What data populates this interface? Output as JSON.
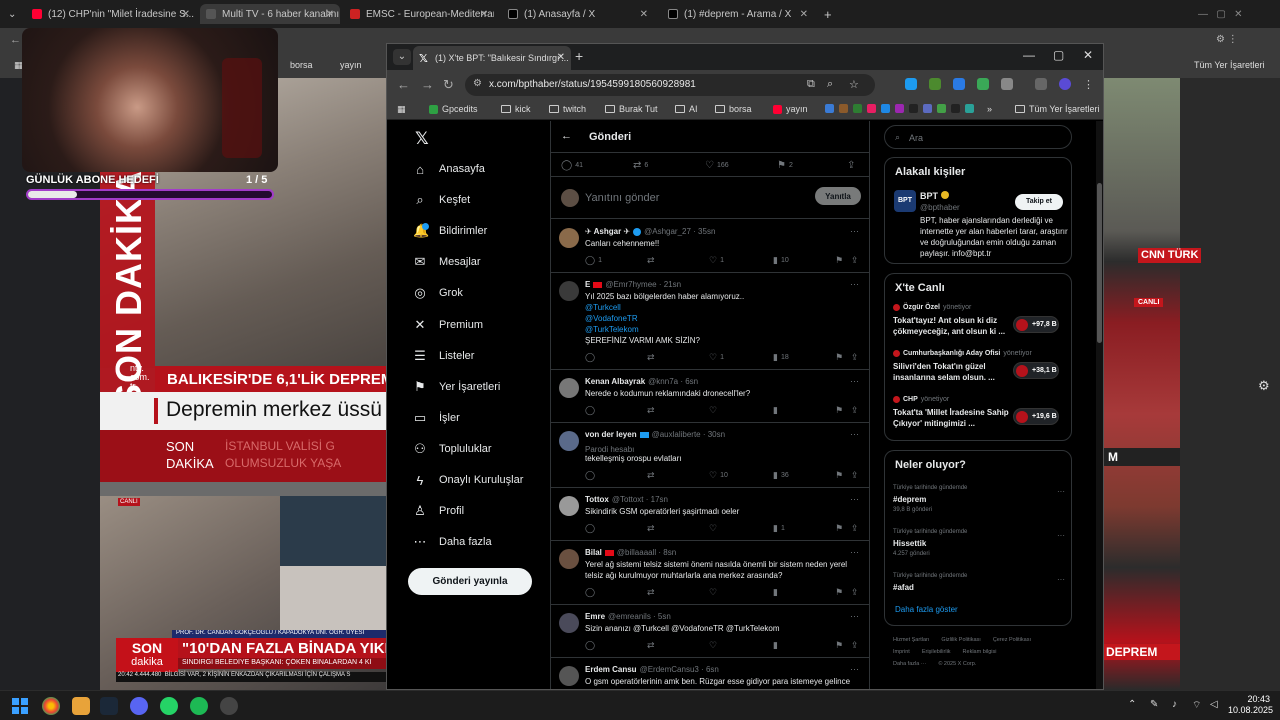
{
  "bg_tabs": [
    {
      "label": "(12) CHP'nin \"Milet İradesine S...",
      "color": "#ff0033"
    },
    {
      "label": "Multi TV - 6 haber kanalını...",
      "color": "#555555"
    },
    {
      "label": "EMSC - European-Mediterrane...",
      "color": "#cc2222"
    },
    {
      "label": "(1) Anasayfa / X",
      "color": "#000000"
    },
    {
      "label": "(1) #deprem - Arama / X",
      "color": "#000000"
    }
  ],
  "bg_bookmarks": {
    "borsa": "borsa",
    "yayin": "yayın",
    "all": "Tüm Yer İşaretleri"
  },
  "stream": {
    "sub_label": "GÜNLÜK ABONE HEDEFİ",
    "sub_count": "1 / 5",
    "sub_progress": 0.2
  },
  "news_left": {
    "vertical": "SON DAKİKA",
    "ntv": "ntv.\ncom.\ntr",
    "headline1": "BALIKESİR'DE 6,1'LİK DEPREM",
    "headline2": "Depremin merkez üssü",
    "son": "SON",
    "dakika": "DAKİKA",
    "ist1": "İSTANBUL VALİSİ G",
    "ist2": "OLUMSUZLUK YAŞA",
    "canli": "CANLI",
    "prof": "PROF. DR. CANDAN GÖKÇEOĞLU / KAPADOKYA ÜNİ. ÖĞR. ÜYESİ",
    "son2": "SON",
    "dakika2": "dakika",
    "head2": "\"10'DAN FAZLA BİNADA YIKILMA",
    "head3": "SINDIRGI BELEDİYE BAŞKANI: ÇÖKEN BİNALARDAN 4 Kİ",
    "ticker": "20:42  4.444.480",
    "bilgi": "BİLGİSİ VAR, 2 KİŞİNİN ENKAZDAN ÇIKARILMASI İÇİN ÇALIŞMA S"
  },
  "news_right": {
    "cnn": "CNN TÜRK",
    "canli": "CANLI",
    "m": "M",
    "dep": "DEPREM"
  },
  "window": {
    "tab_title": "(1) X'te BPT: \"Balıkesir Sındırgı'...",
    "url": "x.com/bpthaber/status/1954599180560928981"
  },
  "bookmarks": [
    {
      "label": "Gpcedits",
      "type": "icon",
      "color": "#2ea043"
    },
    {
      "label": "kick",
      "type": "folder"
    },
    {
      "label": "twitch",
      "type": "folder"
    },
    {
      "label": "Burak Tut",
      "type": "folder"
    },
    {
      "label": "AI",
      "type": "folder"
    },
    {
      "label": "borsa",
      "type": "folder"
    },
    {
      "label": "yayın",
      "type": "icon",
      "color": "#ff0033"
    }
  ],
  "bookmarks_all": "Tüm Yer İşaretleri",
  "nav": {
    "items": [
      {
        "label": "Anasayfa",
        "icon": "⌂"
      },
      {
        "label": "Keşfet",
        "icon": "⌕"
      },
      {
        "label": "Bildirimler",
        "icon": "🔔"
      },
      {
        "label": "Mesajlar",
        "icon": "✉"
      },
      {
        "label": "Grok",
        "icon": "◎"
      },
      {
        "label": "Premium",
        "icon": "✕"
      },
      {
        "label": "Listeler",
        "icon": "☰"
      },
      {
        "label": "Yer İşaretleri",
        "icon": "⚑"
      },
      {
        "label": "İşler",
        "icon": "▭"
      },
      {
        "label": "Topluluklar",
        "icon": "⚇"
      },
      {
        "label": "Onaylı Kuruluşlar",
        "icon": "ϟ"
      },
      {
        "label": "Profil",
        "icon": "♙"
      },
      {
        "label": "Daha fazla",
        "icon": "⋯"
      }
    ],
    "post_button": "Gönderi yayınla"
  },
  "timeline": {
    "title": "Gönderi",
    "metrics": {
      "replies": "41",
      "reposts": "6",
      "likes": "166",
      "bookmarks": "2"
    },
    "reply_placeholder": "Yanıtını gönder",
    "reply_button": "Yanıtla",
    "tweets": [
      {
        "name": "✈ Ashgar ✈",
        "handle": "@Ashgar_27 · 35sn",
        "lines": [
          "Canları cehenneme!!"
        ],
        "reply": "1",
        "repost": "",
        "like": "1",
        "views": "10",
        "avatar": "#8a6a4a",
        "verified": true
      },
      {
        "name": "E",
        "handle": "@Emr7hymee · 21sn",
        "lines": [
          "Yıl 2025 bazı bölgelerden haber alamıyoruz..",
          "@Turkcell",
          "@VodafoneTR",
          "@TurkTelekom",
          "ŞEREFİNİZ VARMI AMK SİZİN?"
        ],
        "reply": "",
        "repost": "",
        "like": "1",
        "views": "18",
        "avatar": "#3a3a3a",
        "flag": "#e30a17"
      },
      {
        "name": "Kenan Albayrak",
        "handle": "@knn7a · 6sn",
        "lines": [
          "Nerede o kodumun reklamındaki dronecell'ler?"
        ],
        "reply": "",
        "repost": "",
        "like": "",
        "views": "",
        "avatar": "#777777"
      },
      {
        "name": "von der leyen",
        "handle": "@auxlaliberte · 30sn",
        "sub": "Parodi hesabı",
        "lines": [
          "tekelleşmiş orospu evlatları"
        ],
        "reply": "",
        "repost": "",
        "like": "10",
        "views": "36",
        "avatar": "#5a6a8a",
        "flag": "#1d9bf0"
      },
      {
        "name": "Tottox",
        "handle": "@Tottoxt · 17sn",
        "lines": [
          "Sikindirik GSM operatörleri şaşirtmadı oeler"
        ],
        "reply": "",
        "repost": "",
        "like": "",
        "views": "1",
        "avatar": "#999999"
      },
      {
        "name": "Bilal",
        "handle": "@billaaaall · 8sn",
        "lines": [
          "Yerel ağ sistemi telsiz sistemi önemi nasılda önemli bir sistem neden yerel",
          "telsiz ağı kurulmuyor muhtarlarla ana merkez arasında?"
        ],
        "reply": "",
        "repost": "",
        "like": "",
        "views": "",
        "avatar": "#6a5040",
        "flag": "#e30a17"
      },
      {
        "name": "Emre",
        "handle": "@emreanils · 5sn",
        "lines": [
          "Sizin ananızı @Turkcell @VodafoneTR @TurkTelekom"
        ],
        "reply": "",
        "repost": "",
        "like": "",
        "views": "",
        "avatar": "#4a4a5a",
        "link_line": true
      },
      {
        "name": "Erdem Cansu",
        "handle": "@ErdemCansu3 · 6sn",
        "lines": [
          "O gsm operatörlerinin amk ben. Rüzgar esse gidiyor para istemeye gelince"
        ],
        "reply": "",
        "repost": "",
        "like": "",
        "views": "",
        "avatar": "#555555"
      }
    ]
  },
  "right": {
    "search_placeholder": "Ara",
    "related_title": "Alakalı kişiler",
    "bpt": {
      "logo": "BPT",
      "name": "BPT",
      "handle": "@bpthaber",
      "follow": "Takip et",
      "bio": "BPT, haber ajanslarından derlediği ve internette yer alan haberleri tarar, araştırır ve doğruluğundan emin olduğu zaman paylaşır. info@bpt.tr"
    },
    "live_title": "X'te Canlı",
    "live": [
      {
        "host": "Özgür Özel",
        "role": "yönetiyor",
        "title": "Tokat'tayız! Ant olsun ki diz çökmeyeceğiz, ant olsun ki ...",
        "count": "+97,8 B",
        "dot": "#c4161c"
      },
      {
        "host": "Cumhurbaşkanlığı Aday Ofisi",
        "role": "yönetiyor",
        "title": "Silivri'den Tokat'ın güzel insanlarına selam olsun. ...",
        "count": "+38,1 B",
        "dot": "#c4161c"
      },
      {
        "host": "CHP",
        "role": "yönetiyor",
        "title": "Tokat'ta 'Millet İradesine Sahip Çıkıyor' mitingimizi ...",
        "count": "+19,6 B",
        "dot": "#c4161c"
      }
    ],
    "trends_title": "Neler oluyor?",
    "trends": [
      {
        "ctx": "Türkiye tarihinde gündemde",
        "title": "#deprem",
        "count": "39,8 B gönderi"
      },
      {
        "ctx": "Türkiye tarihinde gündemde",
        "title": "Hissettik",
        "count": "4.257 gönderi"
      },
      {
        "ctx": "Türkiye tarihinde gündemde",
        "title": "#afad",
        "count": ""
      }
    ],
    "show_more": "Daha fazla göster",
    "footer": [
      "Hizmet Şartları",
      "Gizlilik Politikası",
      "Çerez Politikası",
      "Imprint",
      "Erişilebilirlik",
      "Reklam bilgisi",
      "Daha fazla ···",
      "© 2025 X Corp."
    ]
  },
  "taskbar": {
    "time": "20:43",
    "date": "10.08.2025"
  }
}
